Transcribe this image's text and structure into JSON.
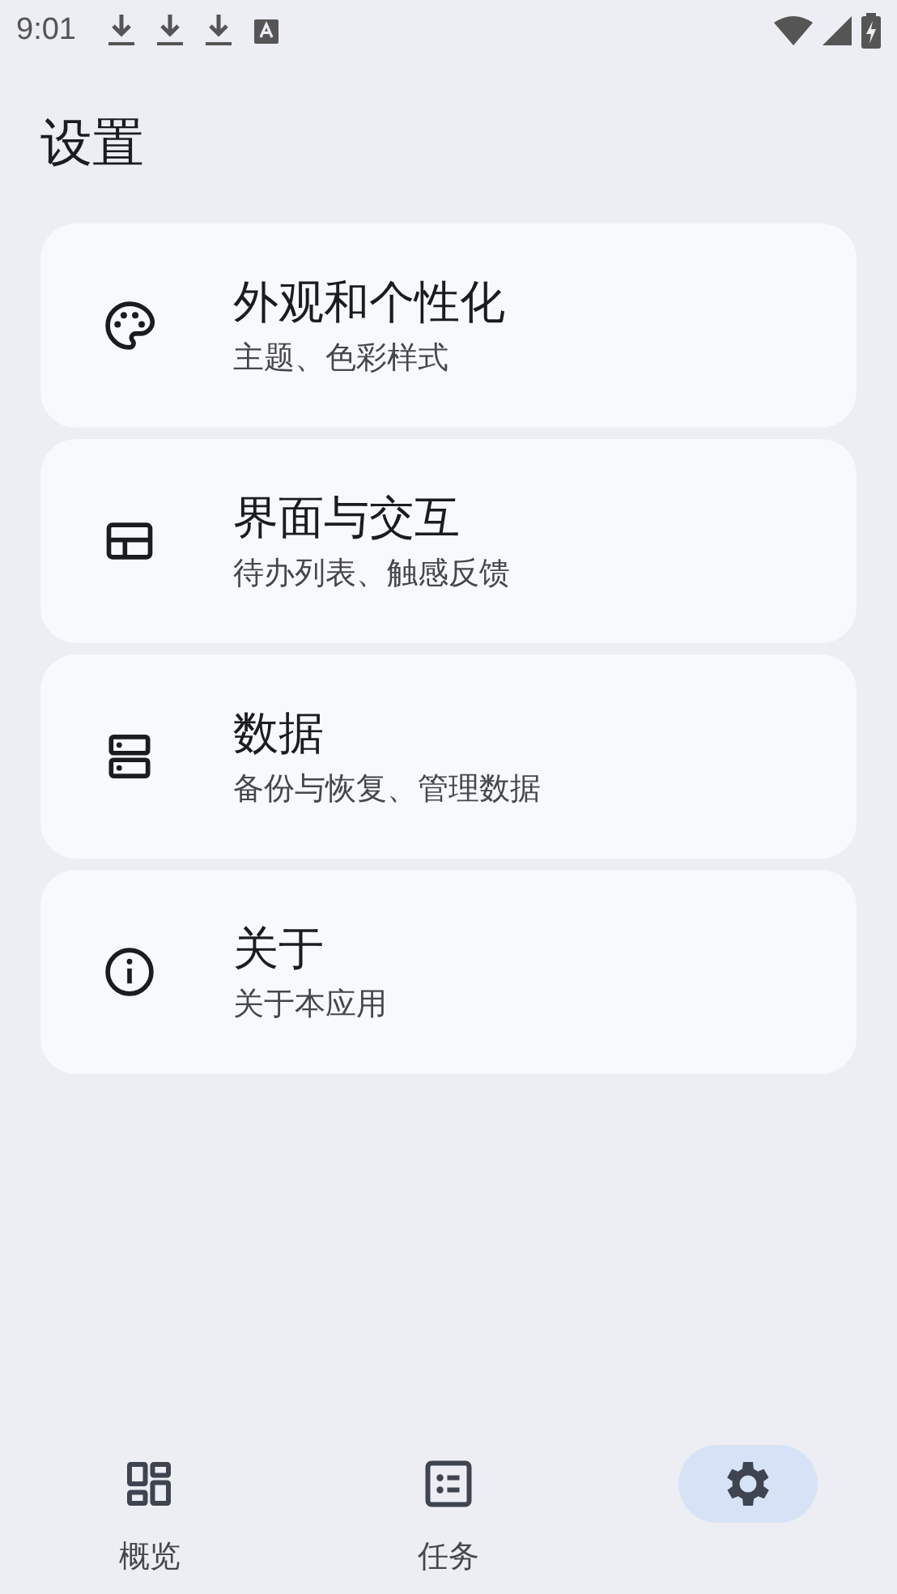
{
  "status_bar": {
    "time": "9:01"
  },
  "title": "设置",
  "settings": [
    {
      "title": "外观和个性化",
      "subtitle": "主题、色彩样式"
    },
    {
      "title": "界面与交互",
      "subtitle": "待办列表、触感反馈"
    },
    {
      "title": "数据",
      "subtitle": "备份与恢复、管理数据"
    },
    {
      "title": "关于",
      "subtitle": "关于本应用"
    }
  ],
  "nav": [
    {
      "label": "概览",
      "selected": false
    },
    {
      "label": "任务",
      "selected": false
    },
    {
      "selected": true
    }
  ]
}
